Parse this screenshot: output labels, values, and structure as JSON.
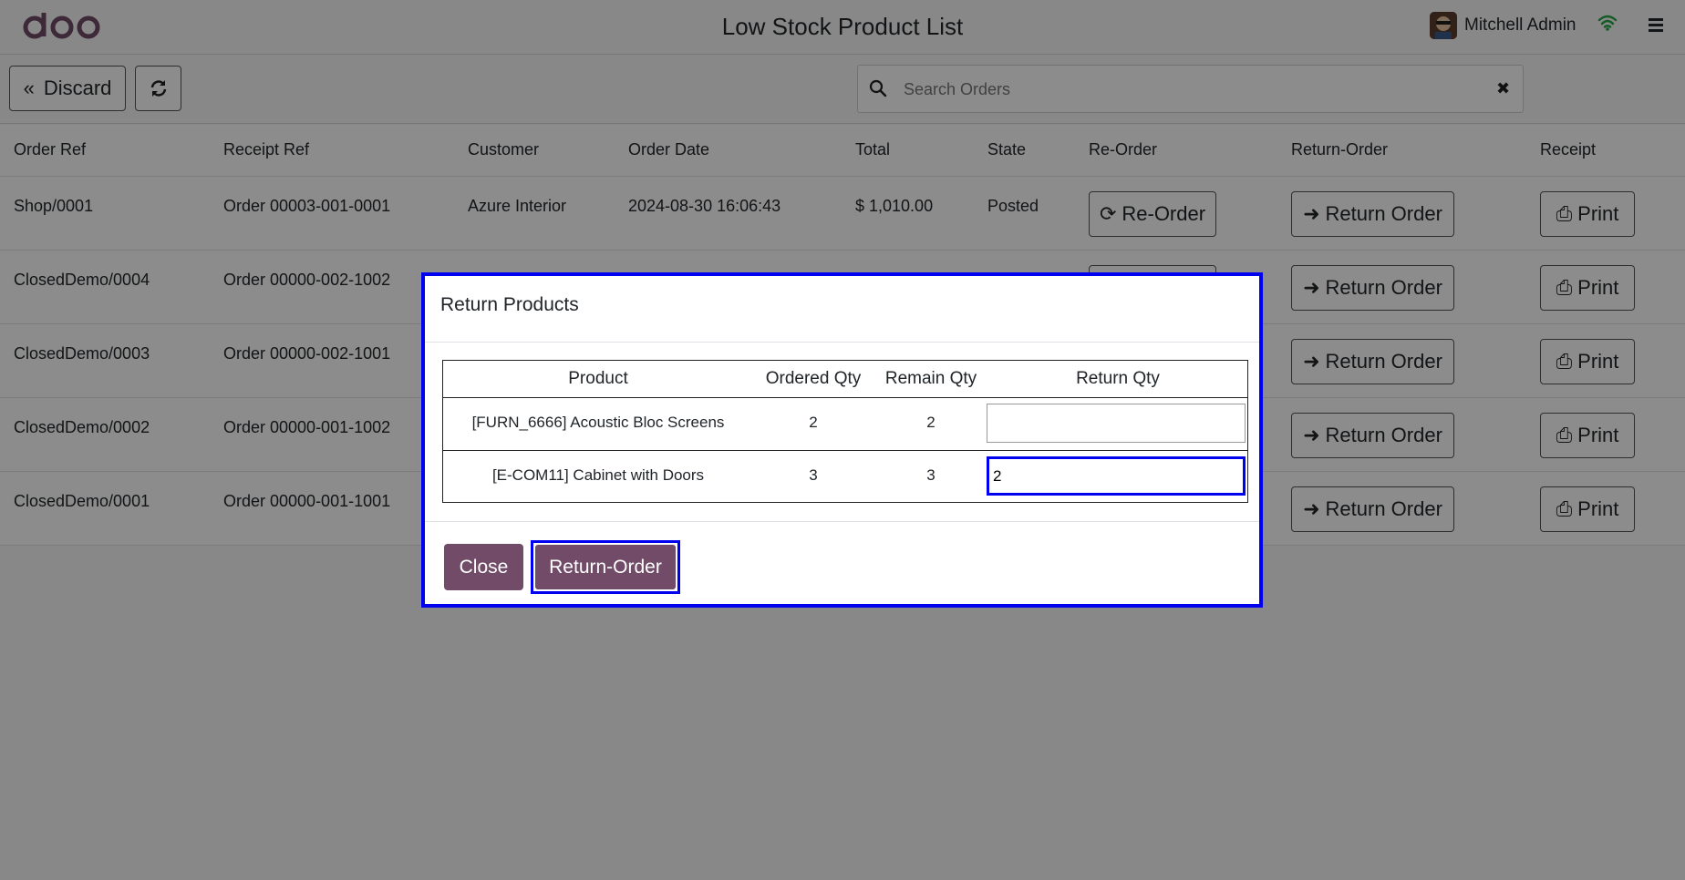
{
  "header": {
    "logo": "odoo",
    "title": "Low Stock Product List",
    "user_name": "Mitchell Admin"
  },
  "controls": {
    "discard_label": "Discard",
    "search_placeholder": "Search Orders"
  },
  "table": {
    "columns": [
      "Order Ref",
      "Receipt Ref",
      "Customer",
      "Order Date",
      "Total",
      "State",
      "Re-Order",
      "Return-Order",
      "Receipt"
    ],
    "rows": [
      {
        "order_ref": "Shop/0001",
        "receipt_ref": "Order 00003-001-0001",
        "customer": "Azure Interior",
        "order_date": "2024-08-30 16:06:43",
        "total": "$ 1,010.00",
        "state": "Posted",
        "reorder": "Re-Order",
        "return_order": "Return Order",
        "print": "Print"
      },
      {
        "order_ref": "ClosedDemo/0004",
        "receipt_ref": "Order 00000-002-1002",
        "customer": "",
        "order_date": "",
        "total": "",
        "state": "",
        "reorder": "",
        "return_order": "Return Order",
        "print": "Print"
      },
      {
        "order_ref": "ClosedDemo/0003",
        "receipt_ref": "Order 00000-002-1001",
        "customer": "",
        "order_date": "",
        "total": "",
        "state": "",
        "reorder": "",
        "return_order": "Return Order",
        "print": "Print"
      },
      {
        "order_ref": "ClosedDemo/0002",
        "receipt_ref": "Order 00000-001-1002",
        "customer": "",
        "order_date": "",
        "total": "",
        "state": "",
        "reorder": "",
        "return_order": "Return Order",
        "print": "Print"
      },
      {
        "order_ref": "ClosedDemo/0001",
        "receipt_ref": "Order 00000-001-1001",
        "customer": "",
        "order_date": "",
        "total": "",
        "state": "",
        "reorder": "",
        "return_order": "Return Order",
        "print": "Print"
      }
    ]
  },
  "modal": {
    "title": "Return Products",
    "columns": [
      "Product",
      "Ordered Qty",
      "Remain Qty",
      "Return Qty"
    ],
    "rows": [
      {
        "product": "[FURN_6666] Acoustic Bloc Screens",
        "ordered_qty": "2",
        "remain_qty": "2",
        "return_qty": ""
      },
      {
        "product": "[E-COM11] Cabinet with Doors",
        "ordered_qty": "3",
        "remain_qty": "3",
        "return_qty": "2"
      }
    ],
    "close_label": "Close",
    "return_label": "Return-Order"
  },
  "colors": {
    "brand": "#714b67",
    "focus": "#0000f0",
    "wifi": "#28a745"
  }
}
